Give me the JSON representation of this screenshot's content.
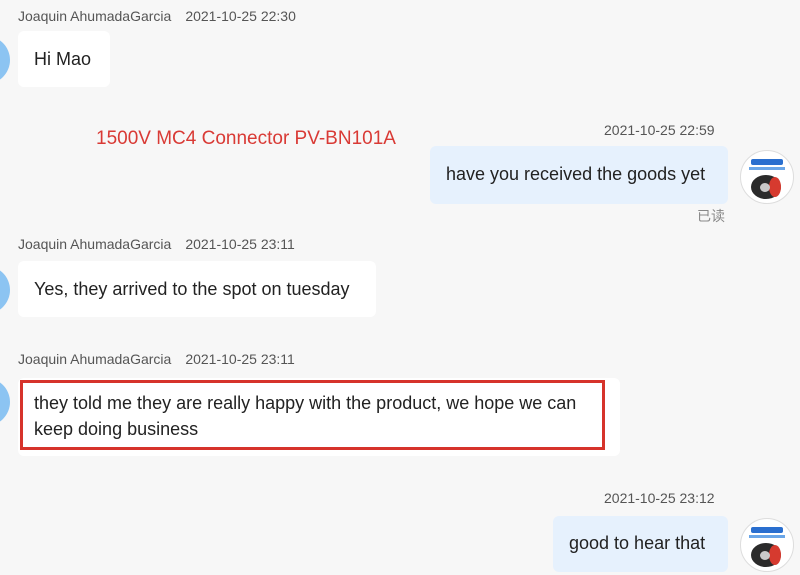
{
  "messages": [
    {
      "sender": "Joaquin AhumadaGarcia",
      "time": "2021-10-25 22:30",
      "text": "Hi Mao"
    },
    {
      "time": "2021-10-25 22:59",
      "text": "have you received the goods yet",
      "status": "已读"
    },
    {
      "sender": "Joaquin AhumadaGarcia",
      "time": "2021-10-25 23:11",
      "text": "Yes, they arrived to the spot on tuesday"
    },
    {
      "sender": "Joaquin AhumadaGarcia",
      "time": "2021-10-25 23:11",
      "text_line1": "they told me they are really happy with the product, we hope we can",
      "text_line2": "keep doing business"
    },
    {
      "time": "2021-10-25 23:12",
      "text": "good to hear that"
    }
  ],
  "product_link": "1500V MC4 Connector PV-BN101A",
  "colors": {
    "highlight": "#d6332b",
    "product_link": "#d93a35",
    "outgoing_bubble": "#e6f1fd",
    "avatar_incoming": "#8cc4f2"
  }
}
